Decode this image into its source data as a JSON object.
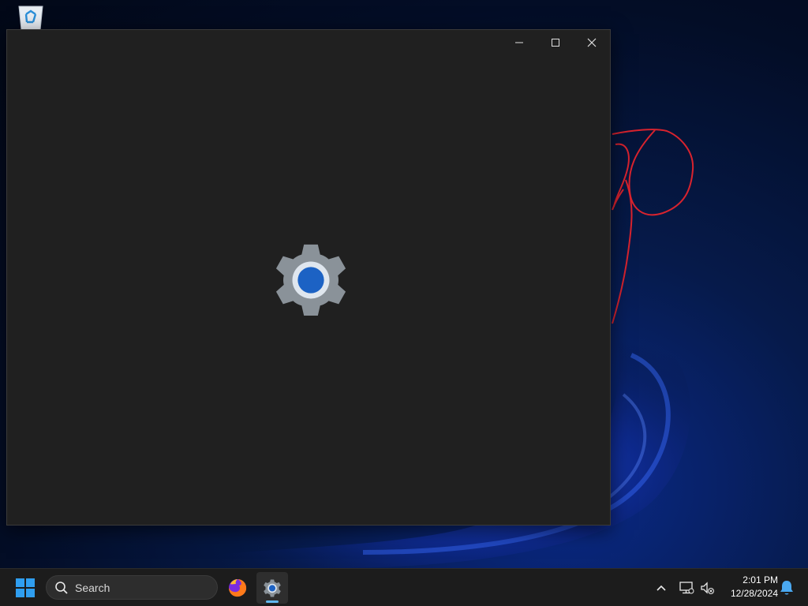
{
  "desktop": {
    "icons": [
      {
        "name": "recycle-bin-icon"
      }
    ]
  },
  "window": {
    "controls": {
      "minimize": "minimize-icon",
      "maximize": "maximize-icon",
      "close": "close-icon"
    },
    "splash_icon": "settings-gear-icon",
    "colors": {
      "background": "#202020",
      "gear": "#8a9299",
      "ring": "#dfe6ee",
      "accent": "#1c62c4"
    }
  },
  "taskbar": {
    "start_icon": "windows-start-icon",
    "search": {
      "placeholder": "Search",
      "icon": "search-icon"
    },
    "pinned": [
      {
        "name": "firefox-icon",
        "active": false
      },
      {
        "name": "settings-icon",
        "active": true
      }
    ],
    "tray": {
      "chevron": "chevron-up-icon",
      "network": "network-icon",
      "volume": "volume-muted-icon",
      "time": "2:01 PM",
      "date": "12/28/2024",
      "notifications": "bell-icon"
    }
  }
}
